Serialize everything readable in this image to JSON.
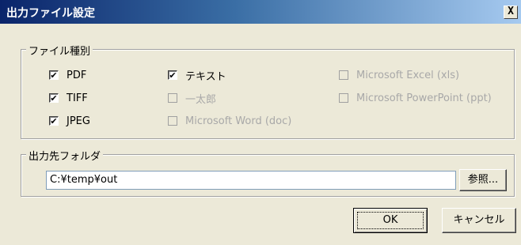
{
  "window": {
    "title": "出力ファイル設定",
    "close_label": "X"
  },
  "file_types": {
    "legend": "ファイル種別",
    "options": [
      {
        "label": "PDF",
        "checked": true,
        "enabled": true
      },
      {
        "label": "TIFF",
        "checked": true,
        "enabled": true
      },
      {
        "label": "JPEG",
        "checked": true,
        "enabled": true
      },
      {
        "label": "テキスト",
        "checked": true,
        "enabled": true
      },
      {
        "label": "一太郎",
        "checked": false,
        "enabled": false
      },
      {
        "label": "Microsoft Word (doc)",
        "checked": false,
        "enabled": false
      },
      {
        "label": "Microsoft Excel (xls)",
        "checked": false,
        "enabled": false
      },
      {
        "label": "Microsoft PowerPoint (ppt)",
        "checked": false,
        "enabled": false
      }
    ]
  },
  "output_folder": {
    "legend": "出力先フォルダ",
    "path": "C:¥temp¥out",
    "browse_label": "参照..."
  },
  "buttons": {
    "ok": "OK",
    "cancel": "キャンセル"
  },
  "check_mark": "✔"
}
